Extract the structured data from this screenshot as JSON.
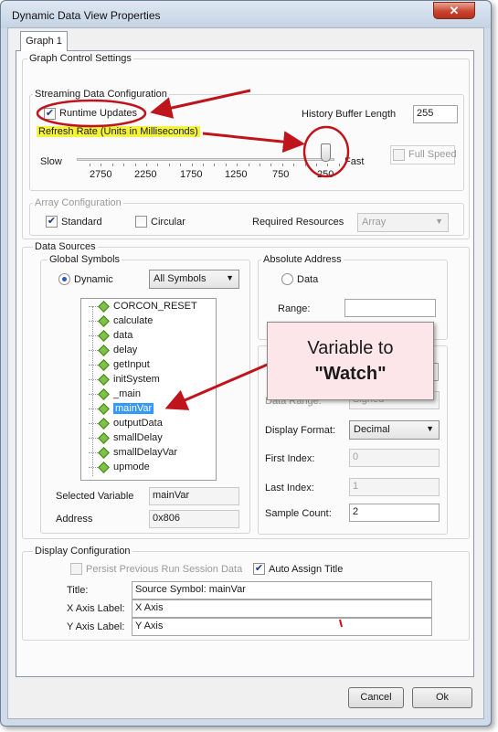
{
  "window": {
    "title": "Dynamic Data View Properties",
    "close_glyph": "✕"
  },
  "tab": {
    "label": "Graph 1"
  },
  "graph_control": {
    "label": "Graph Control Settings",
    "streaming": {
      "label": "Streaming Data Configuration",
      "runtime_updates": {
        "label": "Runtime Updates",
        "checked": true
      },
      "refresh_rate_label": "Refresh Rate (Units in Milliseconds)",
      "history_buffer_label": "History Buffer Length",
      "history_buffer_value": "255",
      "slow_label": "Slow",
      "fast_label": "Fast",
      "ticks": [
        "2750",
        "2250",
        "1750",
        "1250",
        "750",
        "250"
      ],
      "full_speed": {
        "label": "Full Speed",
        "checked": false
      }
    },
    "array": {
      "label": "Array Configuration",
      "standard": {
        "label": "Standard",
        "checked": true
      },
      "circular": {
        "label": "Circular",
        "checked": false
      },
      "required_resources_label": "Required Resources",
      "required_resources_value": "Array"
    }
  },
  "data_sources": {
    "label": "Data Sources",
    "global_symbols": {
      "label": "Global Symbols",
      "dynamic_label": "Dynamic",
      "filter_value": "All Symbols",
      "symbols": [
        "CORCON_RESET",
        "calculate",
        "data",
        "delay",
        "getInput",
        "initSystem",
        "_main",
        "mainVar",
        "outputData",
        "smallDelay",
        "smallDelayVar",
        "upmode"
      ],
      "selected_index": 7,
      "selected_variable_label": "Selected Variable",
      "selected_variable_value": "mainVar",
      "address_label": "Address",
      "address_value": "0x806"
    },
    "absolute_address": {
      "label": "Absolute Address",
      "data_label": "Data",
      "range_label": "Range:",
      "range_value": ""
    },
    "partially_hidden_label": "Data Range:",
    "partially_hidden_value": "Signed",
    "display_format_label": "Display Format:",
    "display_format_value": "Decimal",
    "first_index_label": "First Index:",
    "first_index_value": "0",
    "last_index_label": "Last Index:",
    "last_index_value": "1",
    "sample_count_label": "Sample Count:",
    "sample_count_value": "2"
  },
  "display_config": {
    "label": "Display Configuration",
    "persist": {
      "label": "Persist Previous Run Session Data",
      "checked": false
    },
    "auto_title": {
      "label": "Auto Assign Title",
      "checked": true
    },
    "title_label": "Title:",
    "title_value": "Source Symbol: mainVar",
    "x_axis_label": "X Axis Label:",
    "x_axis_value": "X Axis",
    "y_axis_label": "Y Axis Label:",
    "y_axis_value": "Y Axis"
  },
  "footer": {
    "cancel_label": "Cancel",
    "ok_label": "Ok"
  },
  "annotation": {
    "line1": "Variable to",
    "line2": "\"Watch\""
  },
  "colors": {
    "annotation_red": "#c0141c",
    "highlight_yellow": "#f3f33b",
    "selection_blue": "#3399ff"
  }
}
